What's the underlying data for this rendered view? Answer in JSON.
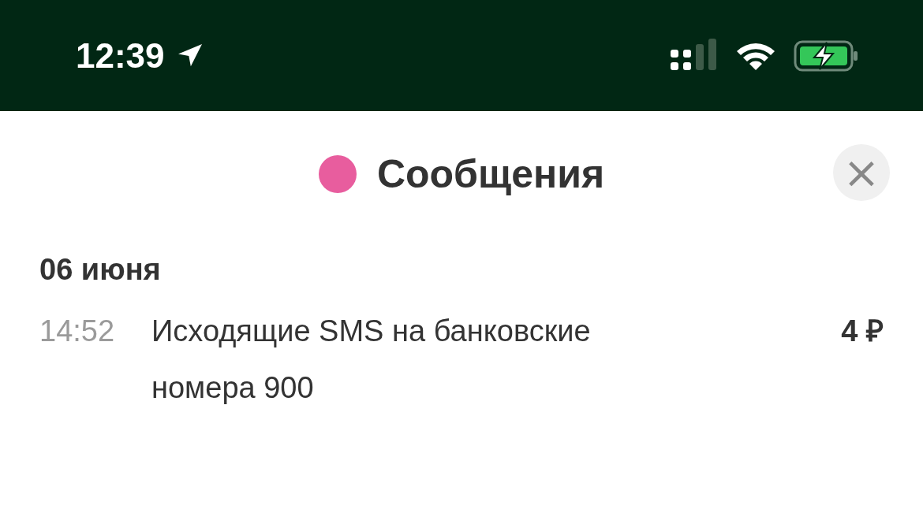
{
  "status_bar": {
    "time": "12:39"
  },
  "header": {
    "title": "Сообщения",
    "color": "#e85d9e",
    "close": "×"
  },
  "groups": [
    {
      "date": "06 июня",
      "items": [
        {
          "time": "14:52",
          "text": "Исходящие SMS на банковские номера 900",
          "amount": "4 ₽"
        }
      ]
    }
  ]
}
